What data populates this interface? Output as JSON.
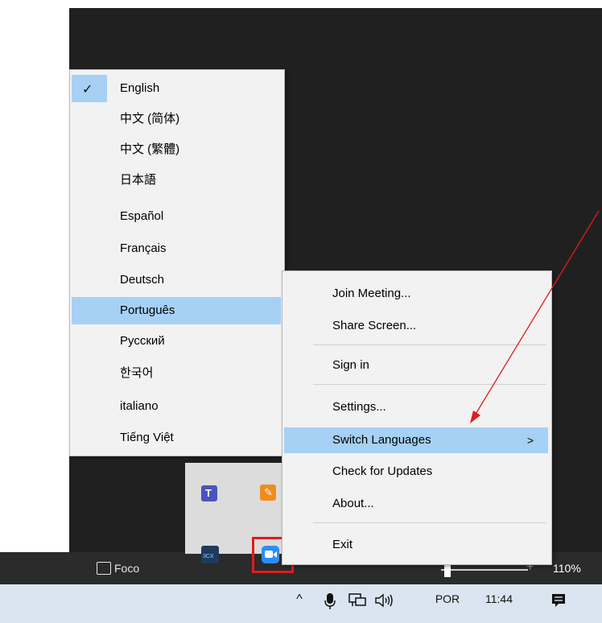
{
  "language_menu": {
    "items": [
      {
        "label": "English",
        "checked": true
      },
      {
        "label": "中文 (简体)"
      },
      {
        "label": "中文 (繁體)"
      },
      {
        "label": "日本語"
      },
      {
        "label": "Español"
      },
      {
        "label": "Français"
      },
      {
        "label": "Deutsch"
      },
      {
        "label": "Português",
        "highlighted": true
      },
      {
        "label": "Русский"
      },
      {
        "label": "한국어"
      },
      {
        "label": "italiano"
      },
      {
        "label": "Tiếng Việt"
      }
    ]
  },
  "context_menu": {
    "items": [
      {
        "label": "Join Meeting..."
      },
      {
        "label": "Share Screen..."
      },
      {
        "label": "Sign in"
      },
      {
        "label": "Settings..."
      },
      {
        "label": "Switch Languages",
        "highlighted": true,
        "submenu_arrow": ">"
      },
      {
        "label": "Check for Updates"
      },
      {
        "label": "About..."
      },
      {
        "label": "Exit"
      }
    ]
  },
  "status_bar": {
    "focus_label": "Foco",
    "zoom": "110%",
    "zoom_plus": "+"
  },
  "taskbar": {
    "chevron": "^",
    "language": "POR",
    "time": "11:44"
  },
  "colors": {
    "menu_bg": "#f2f2f2",
    "highlight": "#a6d1f4",
    "annotation": "#e31a1a"
  },
  "icons": [
    "checkmark-icon",
    "teams-icon",
    "app-icon",
    "3cx-icon",
    "zoom-icon",
    "microphone-icon",
    "network-icon",
    "speaker-icon",
    "notification-icon",
    "focus-icon"
  ]
}
